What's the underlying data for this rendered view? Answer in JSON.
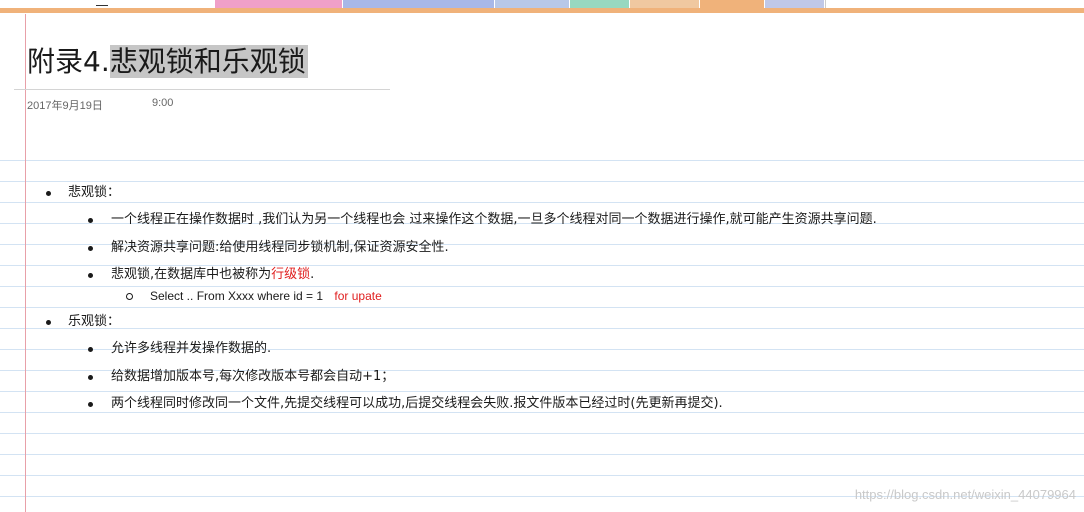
{
  "colors": {
    "accent_bar": "#f0b27a",
    "ruled_line": "#d3e3f3",
    "margin_line": "#e8a0a8",
    "title_highlight": "#c6c6c6",
    "red_text": "#e02020"
  },
  "tabs": [
    {
      "color": "#f0a0c8"
    },
    {
      "color": "#a8b8e8"
    },
    {
      "color": "#b8c8e8"
    },
    {
      "color": "#98d8c0"
    },
    {
      "color": "#f0c8a0"
    },
    {
      "color": "#f0b27a"
    },
    {
      "color": "#c0c8e8"
    },
    {
      "color": "#ffffff"
    }
  ],
  "page": {
    "title_prefix": "附录4.",
    "title_highlighted": "悲观锁和乐观锁",
    "date": "2017年9月19日",
    "time": "9:00"
  },
  "outline": {
    "pessimistic": {
      "label": "悲观锁：",
      "items": [
        "一个线程正在操作数据时 ,我们认为另一个线程也会 过来操作这个数据,一旦多个线程对同一个数据进行操作,就可能产生资源共享问题.",
        "解决资源共享问题:给使用线程同步锁机制,保证资源安全性."
      ],
      "item3_prefix": "悲观锁,在数据库中也被称为",
      "item3_red": "行级锁",
      "item3_suffix": ".",
      "sub_code": "Select ..  From Xxxx  where id = 1",
      "sub_code_red": "for upate"
    },
    "optimistic": {
      "label": "乐观锁：",
      "items": [
        "允许多线程并发操作数据的.",
        "给数据增加版本号,每次修改版本号都会自动+1；",
        "两个线程同时修改同一个文件,先提交线程可以成功,后提交线程会失败.报文件版本已经过时(先更新再提交)."
      ]
    }
  },
  "watermark": "https://blog.csdn.net/weixin_44079964"
}
